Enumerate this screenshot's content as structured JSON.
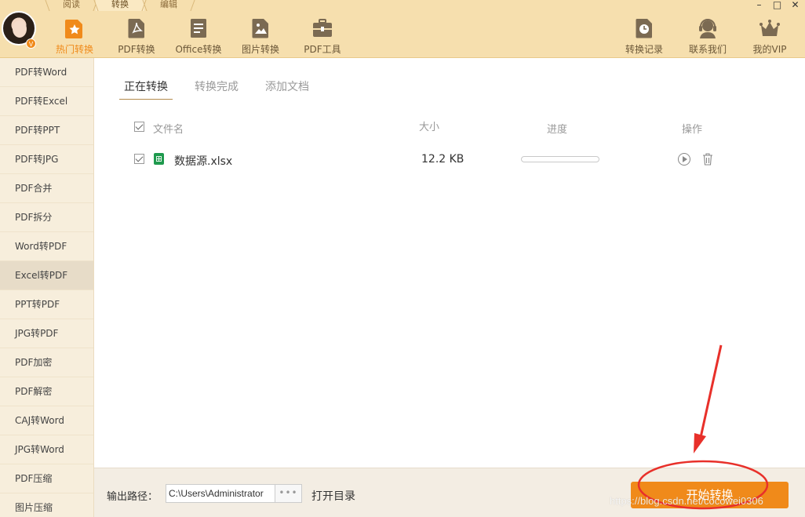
{
  "top_tabs": [
    {
      "label": "阅读",
      "active": false
    },
    {
      "label": "转换",
      "active": true
    },
    {
      "label": "编辑",
      "active": false
    }
  ],
  "avatar": {
    "badge": "V"
  },
  "toolbar": {
    "items": [
      {
        "label": "热门转换",
        "icon": "star-icon",
        "active": true
      },
      {
        "label": "PDF转换",
        "icon": "pdf-icon",
        "active": false
      },
      {
        "label": "Office转换",
        "icon": "document-icon",
        "active": false
      },
      {
        "label": "图片转换",
        "icon": "image-icon",
        "active": false
      },
      {
        "label": "PDF工具",
        "icon": "toolbox-icon",
        "active": false
      }
    ],
    "right_items": [
      {
        "label": "转换记录",
        "icon": "clock-icon"
      },
      {
        "label": "联系我们",
        "icon": "headset-icon"
      },
      {
        "label": "我的VIP",
        "icon": "crown-icon"
      }
    ]
  },
  "window_controls": {
    "minimize": "–",
    "maximize": "□",
    "close": "✕"
  },
  "sidebar": {
    "items": [
      {
        "label": "PDF转Word",
        "active": false
      },
      {
        "label": "PDF转Excel",
        "active": false
      },
      {
        "label": "PDF转PPT",
        "active": false
      },
      {
        "label": "PDF转JPG",
        "active": false
      },
      {
        "label": "PDF合并",
        "active": false
      },
      {
        "label": "PDF拆分",
        "active": false
      },
      {
        "label": "Word转PDF",
        "active": false
      },
      {
        "label": "Excel转PDF",
        "active": true
      },
      {
        "label": "PPT转PDF",
        "active": false
      },
      {
        "label": "JPG转PDF",
        "active": false
      },
      {
        "label": "PDF加密",
        "active": false
      },
      {
        "label": "PDF解密",
        "active": false
      },
      {
        "label": "CAJ转Word",
        "active": false
      },
      {
        "label": "JPG转Word",
        "active": false
      },
      {
        "label": "PDF压缩",
        "active": false
      },
      {
        "label": "图片压缩",
        "active": false
      }
    ]
  },
  "main": {
    "tabs": [
      {
        "label": "正在转换",
        "active": true
      },
      {
        "label": "转换完成",
        "active": false
      },
      {
        "label": "添加文档",
        "active": false
      }
    ],
    "table": {
      "headers": {
        "name": "文件名",
        "size": "大小",
        "progress": "进度",
        "actions": "操作"
      },
      "rows": [
        {
          "checked": true,
          "file_name": "数据源.xlsx",
          "file_icon": "excel-file-icon",
          "size": "12.2 KB",
          "progress": 0
        }
      ]
    }
  },
  "footer": {
    "output_label": "输出路径：",
    "output_path": "C:\\Users\\Administrator",
    "browse_label": "•••",
    "open_dir_label": "打开目录",
    "start_label": "开始转换"
  },
  "watermark": "https://blog.csdn.net/cocowei0306",
  "colors": {
    "accent": "#f08a1a",
    "topbar": "#f6dfae",
    "sidebar": "#f7eedc",
    "annotation": "#e8302a"
  }
}
